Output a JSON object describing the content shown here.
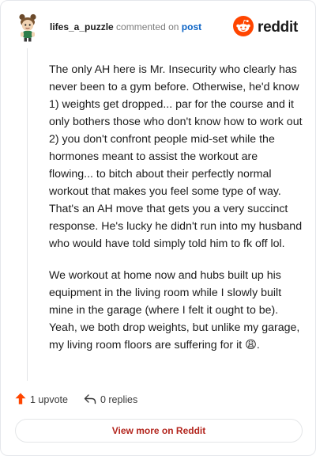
{
  "header": {
    "username": "lifes_a_puzzle",
    "action_text": "commented on",
    "post_link": "post",
    "brand": "reddit"
  },
  "comment": {
    "paragraphs": [
      "The only AH here is Mr. Insecurity who clearly has never been to a gym before. Otherwise, he'd know 1) weights get dropped... par for the course and it only bothers those who don't know how to work out 2) you don't confront people mid-set while the hormones meant to assist the workout are flowing... to bitch about their perfectly normal workout that makes you feel some type of way. That's an AH move that gets you a very succinct response. He's lucky he didn't run into my husband who would have told simply told him to fk off lol.",
      "We workout at home now and hubs built up his equipment in the living room while I slowly built mine in the garage (where I felt it ought to be). Yeah, we both drop weights, but unlike my garage, my living room floors are suffering for it",
      "😩",
      "."
    ]
  },
  "actions": {
    "upvote_label": "1 upvote",
    "replies_label": "0 replies"
  },
  "footer": {
    "view_more_label": "View more on Reddit"
  },
  "colors": {
    "brand_orange": "#ff4500",
    "link_blue": "#0b63c5",
    "view_more_red": "#b3261e"
  },
  "icons": {
    "avatar": "avatar-icon",
    "brand": "reddit-logo-icon",
    "upvote": "upvote-arrow-icon",
    "reply": "reply-arrow-icon"
  }
}
